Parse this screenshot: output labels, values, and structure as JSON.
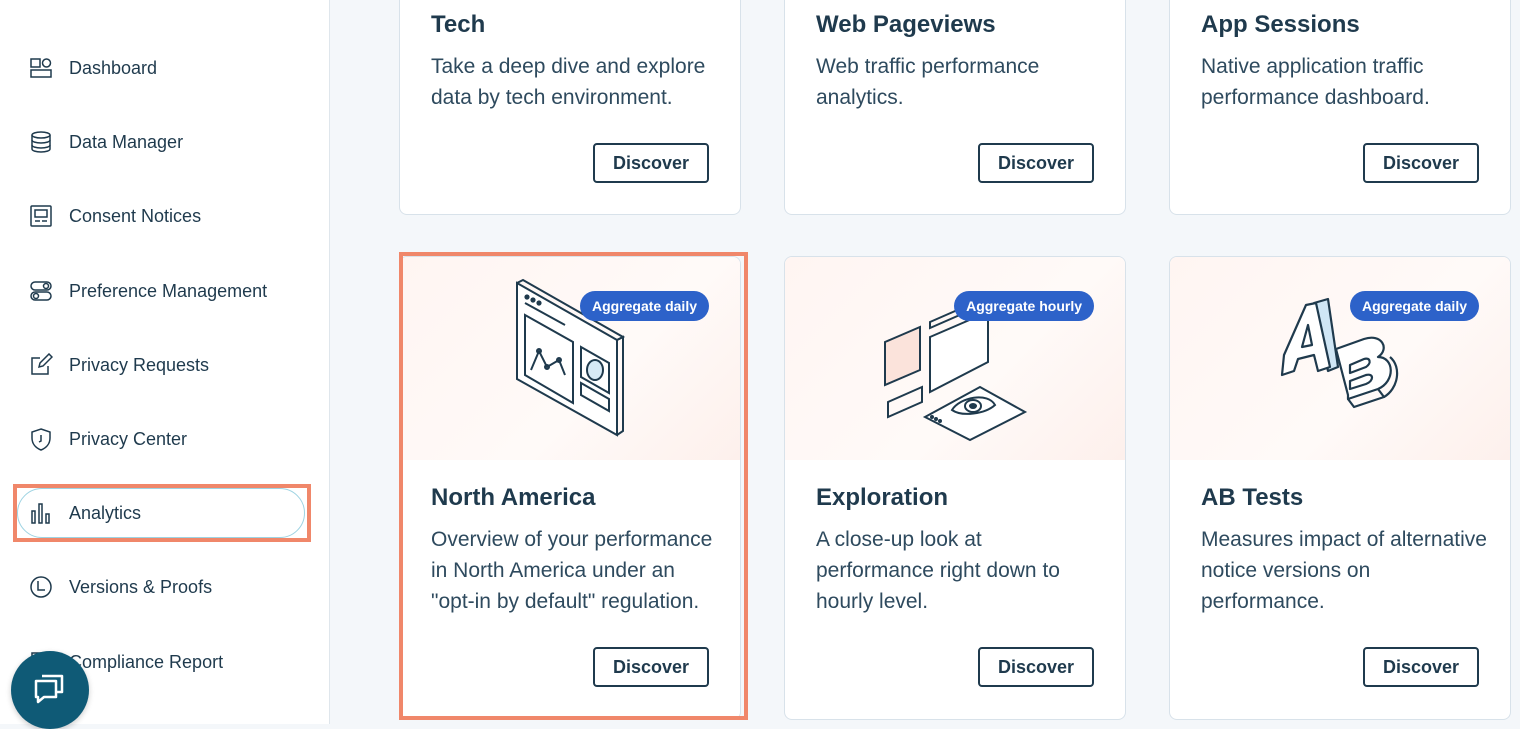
{
  "sidebar": {
    "items": [
      {
        "label": "Dashboard",
        "icon": "dashboard-icon"
      },
      {
        "label": "Data Manager",
        "icon": "database-icon"
      },
      {
        "label": "Consent Notices",
        "icon": "consent-notice-icon"
      },
      {
        "label": "Preference Management",
        "icon": "toggle-icon"
      },
      {
        "label": "Privacy Requests",
        "icon": "edit-request-icon"
      },
      {
        "label": "Privacy Center",
        "icon": "shield-icon"
      },
      {
        "label": "Analytics",
        "icon": "bar-chart-icon"
      },
      {
        "label": "Versions & Proofs",
        "icon": "history-icon"
      },
      {
        "label": "Compliance Report",
        "icon": "report-icon"
      }
    ],
    "active_item": "Analytics"
  },
  "cards_top": [
    {
      "title": "Tech",
      "description": "Take a deep dive and explore data by tech environment.",
      "button": "Discover"
    },
    {
      "title": "Web Pageviews",
      "description": "Web traffic performance analytics.",
      "button": "Discover"
    },
    {
      "title": "App Sessions",
      "description": "Native application traffic performance dashboard.",
      "button": "Discover"
    }
  ],
  "cards_bottom": [
    {
      "title": "North America",
      "description": "Overview of your performance in North America under an \"opt-in by default\" regulation.",
      "button": "Discover",
      "badge": "Aggregate daily",
      "illustration": "dashboard-screen-illustration"
    },
    {
      "title": "Exploration",
      "description": "A close-up look at performance right down to hourly level.",
      "button": "Discover",
      "badge": "Aggregate hourly",
      "illustration": "eye-exploration-illustration"
    },
    {
      "title": "AB Tests",
      "description": "Measures impact of alternative notice versions on performance.",
      "button": "Discover",
      "badge": "Aggregate daily",
      "illustration": "ab-letters-illustration"
    }
  ],
  "colors": {
    "text": "#1f3a4d",
    "badge": "#2d62c9",
    "highlight": "#f0876a",
    "chat": "#0f5a76"
  },
  "chat_button": {
    "icon": "chat-icon"
  }
}
